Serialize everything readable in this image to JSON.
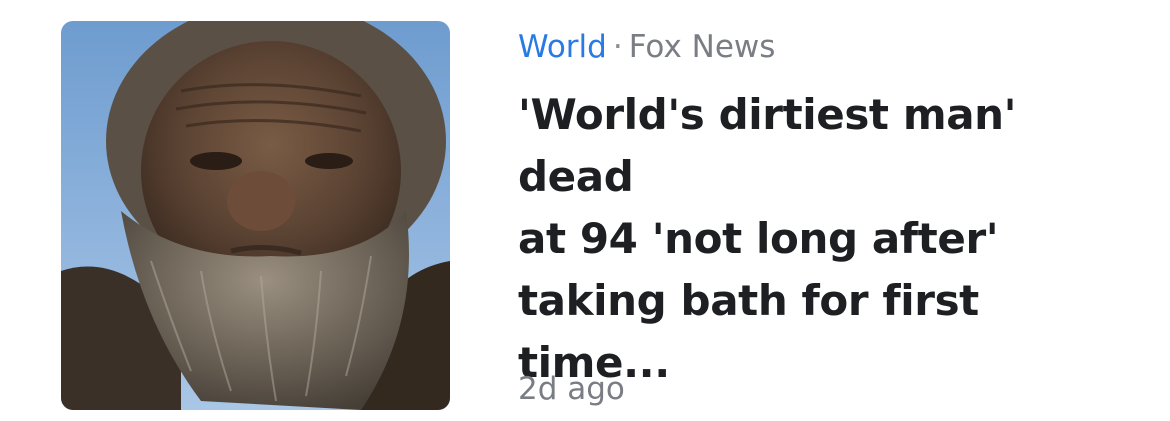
{
  "article": {
    "category": "World",
    "separator": "·",
    "source": "Fox News",
    "headline_lines": [
      "'World's dirtiest man' dead",
      "at 94 'not long after'",
      "taking bath for first time..."
    ],
    "time_ago": "2d ago",
    "thumbnail": "photo-of-elderly-bearded-man"
  },
  "colors": {
    "category": "#2a7ae4",
    "meta_gray": "#7a7d84",
    "headline": "#1d1f23",
    "sky": "#8fb4dd"
  }
}
